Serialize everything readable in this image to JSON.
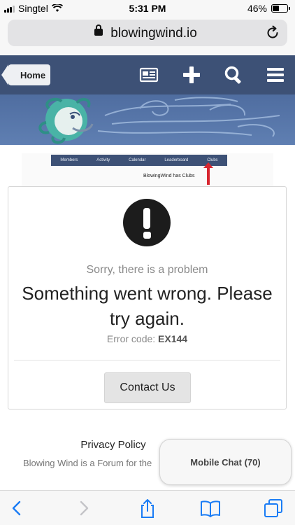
{
  "status_bar": {
    "carrier": "Singtel",
    "time": "5:31 PM",
    "battery_percent": "46%",
    "battery_level": 0.46
  },
  "browser": {
    "url": "blowingwind.io"
  },
  "site_nav": {
    "home_label": "Home",
    "icons": [
      "news-icon",
      "plus-icon",
      "search-icon",
      "menu-icon"
    ]
  },
  "club_screenshot": {
    "nav_items": [
      "Members",
      "Activity",
      "Calendar",
      "Leaderboard",
      "Clubs"
    ],
    "caption": "BlowingWind has Clubs"
  },
  "error": {
    "subtitle": "Sorry, there is a problem",
    "title": "Something went wrong. Please try again.",
    "code_label": "Error code:",
    "code": "EX144",
    "contact_label": "Contact Us"
  },
  "footer": {
    "privacy_label": "Privacy Policy",
    "tagline": "Blowing Wind is a Forum for the"
  },
  "chat": {
    "label": "Mobile Chat (70)"
  },
  "colors": {
    "nav_bg": "#3d5176",
    "banner_bg": "#5774a6",
    "accent_arrow": "#d7262f",
    "ios_blue": "#1a7cf5"
  }
}
